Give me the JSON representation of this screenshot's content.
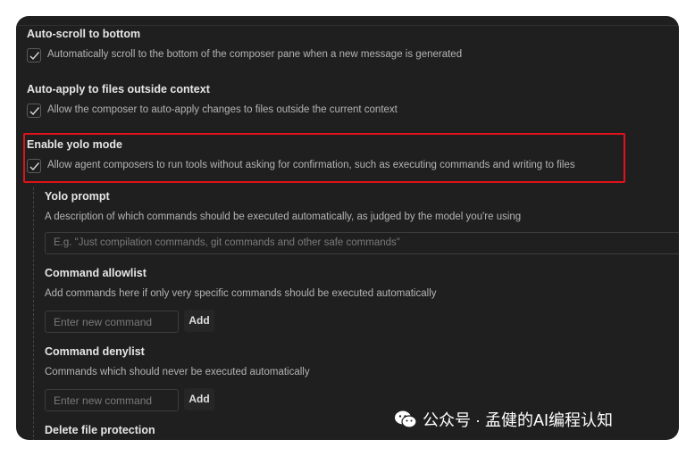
{
  "settings": {
    "auto_scroll": {
      "title": "Auto-scroll to bottom",
      "description": "Automatically scroll to the bottom of the composer pane when a new message is generated",
      "checked": true
    },
    "auto_apply": {
      "title": "Auto-apply to files outside context",
      "description": "Allow the composer to auto-apply changes to files outside the current context",
      "checked": true
    },
    "yolo": {
      "title": "Enable yolo mode",
      "description": "Allow agent composers to run tools without asking for confirmation, such as executing commands and writing to files",
      "checked": true
    },
    "yolo_prompt": {
      "title": "Yolo prompt",
      "description": "A description of which commands should be executed automatically, as judged by the model you're using",
      "placeholder": "E.g. \"Just compilation commands, git commands and other safe commands\""
    },
    "allowlist": {
      "title": "Command allowlist",
      "description": "Add commands here if only very specific commands should be executed automatically",
      "placeholder": "Enter new command",
      "add_label": "Add"
    },
    "denylist": {
      "title": "Command denylist",
      "description": "Commands which should never be executed automatically",
      "placeholder": "Enter new command",
      "add_label": "Add"
    },
    "delete_protection": {
      "title": "Delete file protection"
    }
  },
  "watermark": {
    "text": "公众号 · 孟健的AI编程认知",
    "icon": "wechat-icon"
  },
  "colors": {
    "background": "#1f1f1f",
    "highlight": "#e0121b"
  }
}
